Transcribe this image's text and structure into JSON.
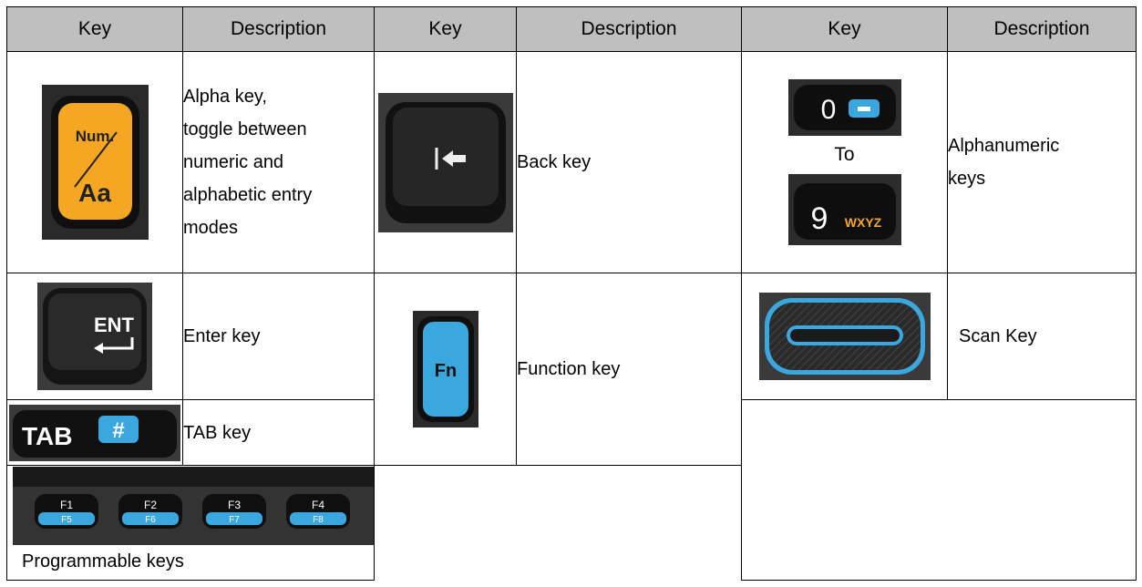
{
  "headers": [
    "Key",
    "Description",
    "Key",
    "Description",
    "Key",
    "Description"
  ],
  "rows": {
    "alpha": {
      "desc_lines": [
        "Alpha key,",
        "toggle between",
        "numeric and",
        "alphabetic entry",
        "modes"
      ],
      "icon_top": "Num.",
      "icon_bottom": "Aa"
    },
    "back": {
      "desc": "Back key"
    },
    "alnum": {
      "desc_lines": [
        "Alphanumeric",
        "keys"
      ],
      "from_key": "0",
      "to_label": "To",
      "to_key": "9",
      "to_letters": "WXYZ"
    },
    "enter": {
      "desc": "Enter key",
      "icon_label": "ENT"
    },
    "function": {
      "desc": "Function key",
      "icon_label": "Fn"
    },
    "scan": {
      "desc": "Scan Key"
    },
    "tab": {
      "desc": "TAB key",
      "icon_label": "TAB",
      "icon_symbol": "#"
    },
    "programmable": {
      "desc": "Programmable keys",
      "keys": [
        {
          "top": "F1",
          "bottom": "F5"
        },
        {
          "top": "F2",
          "bottom": "F6"
        },
        {
          "top": "F3",
          "bottom": "F7"
        },
        {
          "top": "F4",
          "bottom": "F8"
        }
      ]
    }
  },
  "colors": {
    "header_bg": "#bfbfbf",
    "key_orange": "#f5a623",
    "key_blue": "#3aa7df",
    "key_dark": "#1d1d1d"
  }
}
